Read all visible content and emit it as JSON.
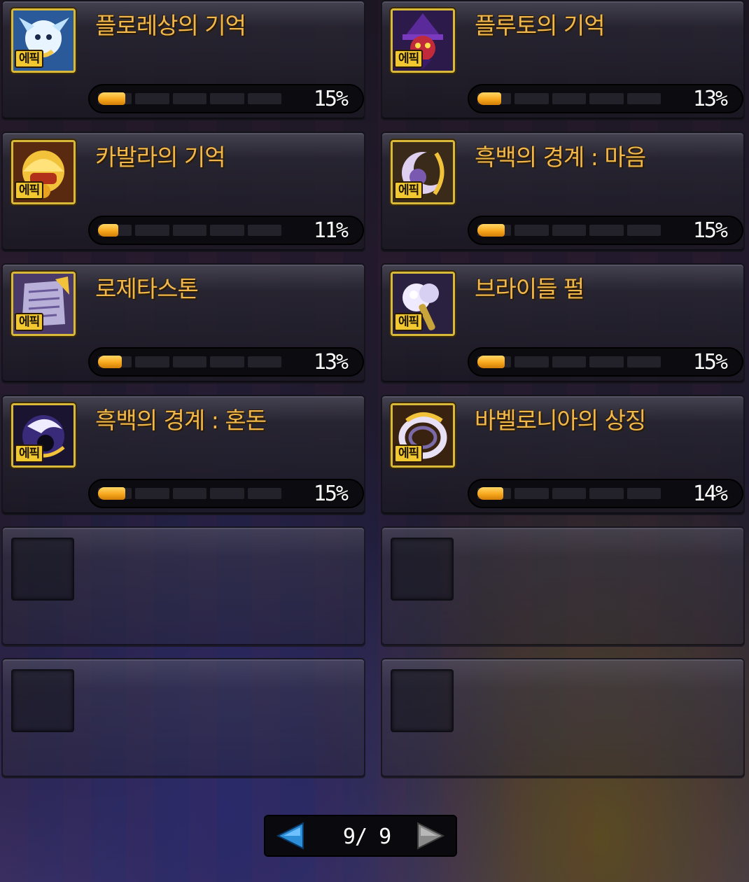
{
  "items": [
    {
      "name": "플로레상의 기억",
      "progress": "15%",
      "fill": 0.15,
      "badge": "에픽",
      "icon": "dragon-spirit-icon"
    },
    {
      "name": "플루토의 기억",
      "progress": "13%",
      "fill": 0.13,
      "badge": "에픽",
      "icon": "pluto-mage-icon"
    },
    {
      "name": "카발라의 기억",
      "progress": "11%",
      "fill": 0.11,
      "badge": "에픽",
      "icon": "golden-helmet-icon"
    },
    {
      "name": "흑백의 경계 : 마음",
      "progress": "15%",
      "fill": 0.15,
      "badge": "에픽",
      "icon": "crescent-orb-icon"
    },
    {
      "name": "로제타스톤",
      "progress": "13%",
      "fill": 0.13,
      "badge": "에픽",
      "icon": "rosetta-stone-icon"
    },
    {
      "name": "브라이들 펄",
      "progress": "15%",
      "fill": 0.15,
      "badge": "에픽",
      "icon": "pearl-mace-icon"
    },
    {
      "name": "흑백의 경계 : 혼돈",
      "progress": "15%",
      "fill": 0.15,
      "badge": "에픽",
      "icon": "chaos-orb-icon"
    },
    {
      "name": "바벨로니아의 상징",
      "progress": "14%",
      "fill": 0.14,
      "badge": "에픽",
      "icon": "babelonia-ring-icon"
    }
  ],
  "empty_slots": 4,
  "pagination": {
    "current": "9",
    "separator": "/",
    "total": "9",
    "prev_icon": "arrow-left-icon",
    "next_icon": "arrow-right-icon"
  },
  "colors": {
    "title": "#f0b84c",
    "bar_fill": "#f7a71c",
    "icon_frame": "#d9b93a",
    "badge_bg": "#f2c830",
    "prev_arrow": "#2c8fd8",
    "next_arrow": "#8a8a8a"
  }
}
